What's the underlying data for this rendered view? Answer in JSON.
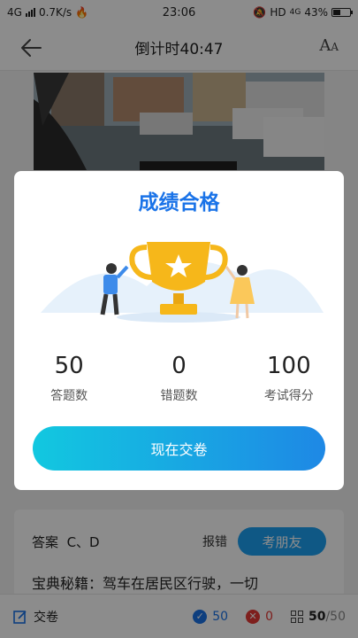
{
  "status_bar": {
    "network": "4G",
    "speed": "0.7K/s",
    "time": "23:06",
    "hd": "HD",
    "hd_network": "4G",
    "battery_percent": "43%",
    "battery_level": 0.43
  },
  "header": {
    "title": "倒计时40:47",
    "font_icon": "A",
    "font_icon_small": "A"
  },
  "answer_card": {
    "answer_label": "答案",
    "answer_value": "C、D",
    "report_label": "报错",
    "ask_friend_label": "考朋友",
    "tip_text": "宝典秘籍：驾车在居民区行驶，一切"
  },
  "bottom_bar": {
    "submit_label": "交卷",
    "correct_count": "50",
    "wrong_count": "0",
    "progress_current": "50",
    "progress_total": "/50"
  },
  "result_modal": {
    "title": "成绩合格",
    "stats": [
      {
        "value": "50",
        "label": "答题数"
      },
      {
        "value": "0",
        "label": "错题数"
      },
      {
        "value": "100",
        "label": "考试得分"
      }
    ],
    "submit_now_label": "现在交卷"
  },
  "colors": {
    "accent": "#1a73e8",
    "button_gradient_start": "#12c8e0",
    "button_gradient_end": "#1e88e5",
    "trophy": "#f6b71a",
    "wrong": "#e53935"
  }
}
